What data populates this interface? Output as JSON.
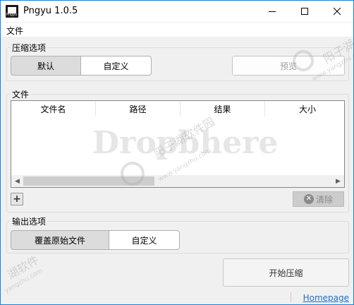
{
  "window": {
    "title": "Pngyu 1.0.5",
    "icon_text": "Pngyu"
  },
  "titlebar": {
    "minimize_icon": "minimize-icon",
    "maximize_icon": "maximize-icon",
    "close_icon": "close-icon"
  },
  "menubar": {
    "file_label": "文件"
  },
  "compression": {
    "title": "压缩选项",
    "default_label": "默认",
    "custom_label": "自定义",
    "preview_label": "预览"
  },
  "files": {
    "title": "文件",
    "columns": [
      "文件名",
      "路径",
      "结果",
      "大小"
    ],
    "add_label": "+",
    "clear_label": "清除"
  },
  "output": {
    "title": "输出选项",
    "overwrite_label": "覆盖原始文件",
    "custom_label": "自定义"
  },
  "actions": {
    "start_label": "开始压缩",
    "homepage_label": "Homepage"
  },
  "watermarks": {
    "center_big": "Dropbhere",
    "center_cn": "阳子湖软件园",
    "center_url": "www.yangzhu.com",
    "top_right_cn": "阳子湖",
    "top_right_url": "www.yangzhu.com",
    "bottom_left_cn": "湖软件",
    "bottom_left_url": "yangzhu.com"
  }
}
